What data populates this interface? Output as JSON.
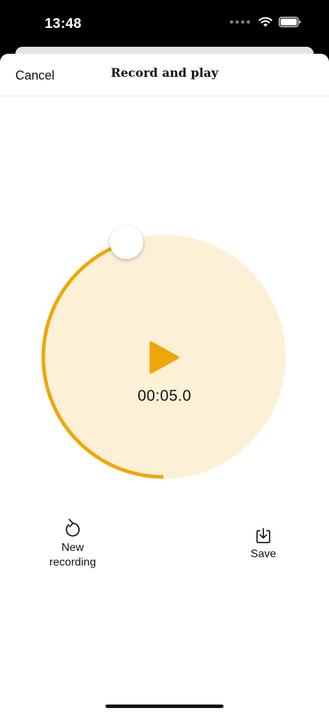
{
  "status_bar": {
    "time": "13:48",
    "icons": [
      "signal-dots-icon",
      "wifi-icon",
      "battery-icon"
    ]
  },
  "nav": {
    "cancel_label": "Cancel",
    "title": "Record and play"
  },
  "player": {
    "elapsed": "00:05.0",
    "progress_fraction": 0.45,
    "icon": "play-icon"
  },
  "actions": {
    "new_recording_label_line1": "New",
    "new_recording_label_line2": "recording",
    "new_recording_icon": "rotate-ccw-icon",
    "save_label": "Save",
    "save_icon": "download-tray-icon"
  },
  "colors": {
    "accent": "#F0A608",
    "accent_light": "#FCF1D6",
    "text": "#111111",
    "background": "#FFFFFF"
  }
}
